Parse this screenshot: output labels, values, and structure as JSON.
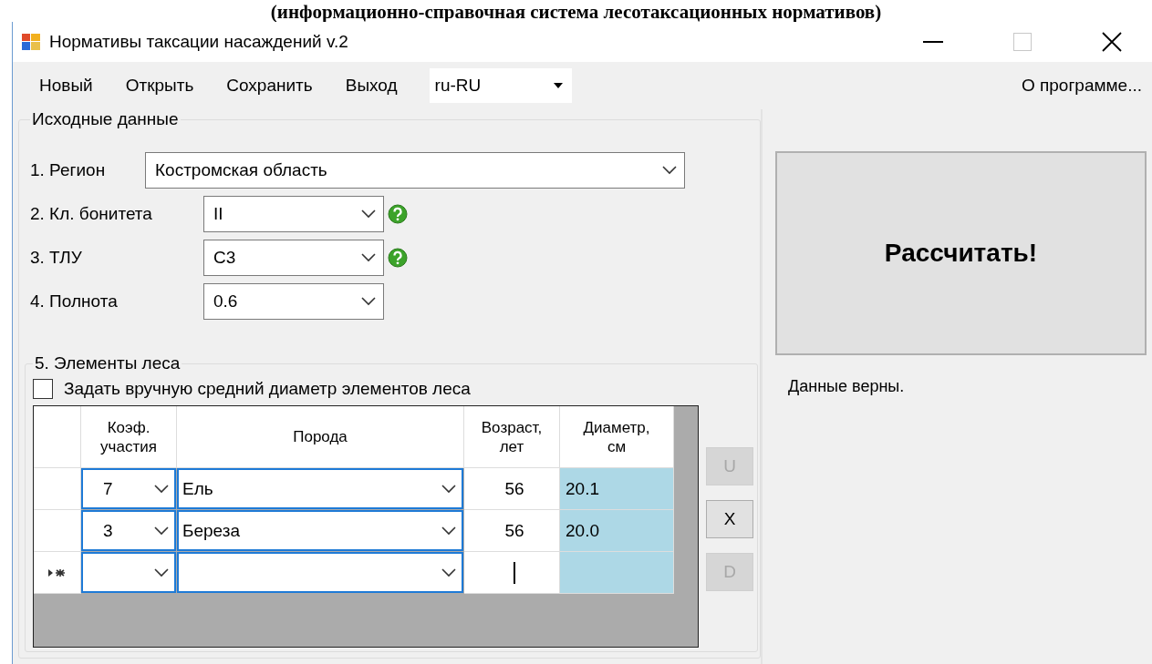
{
  "caption": "(информационно-справочная система лесотаксационных нормативов)",
  "window": {
    "title": "Нормативы таксации насаждений v.2"
  },
  "menu": {
    "items": [
      "Новый",
      "Открыть",
      "Сохранить",
      "Выход"
    ],
    "language": "ru-RU",
    "about": "О программе..."
  },
  "inputs": {
    "legend": "Исходные данные",
    "fields": [
      {
        "label": "1. Регион",
        "value": "Костромская область",
        "help": false,
        "wide": true
      },
      {
        "label": "2. Кл. бонитета",
        "value": "II",
        "help": true,
        "wide": false
      },
      {
        "label": "3. ТЛУ",
        "value": "C3",
        "help": true,
        "wide": false
      },
      {
        "label": "4. Полнота",
        "value": "0.6",
        "help": false,
        "wide": false
      }
    ]
  },
  "elements": {
    "legend": "5. Элементы леса",
    "checkbox": {
      "label": "Задать вручную средний диаметр элементов леса",
      "checked": false
    },
    "columns": [
      "Коэф.\nучастия",
      "Порода",
      "Возраст,\nлет",
      "Диаметр,\nсм"
    ],
    "rows": [
      {
        "coef": "7",
        "species": "Ель",
        "age": "56",
        "diameter": "20.1",
        "new": false,
        "editing": false
      },
      {
        "coef": "3",
        "species": "Береза",
        "age": "56",
        "diameter": "20.0",
        "new": false,
        "editing": false
      },
      {
        "new": true,
        "editing": true
      }
    ],
    "buttons": [
      {
        "label": "U",
        "disabled": true
      },
      {
        "label": "X",
        "disabled": false
      },
      {
        "label": "D",
        "disabled": true
      }
    ]
  },
  "calculate": "Рассчитать!",
  "status": "Данные верны."
}
